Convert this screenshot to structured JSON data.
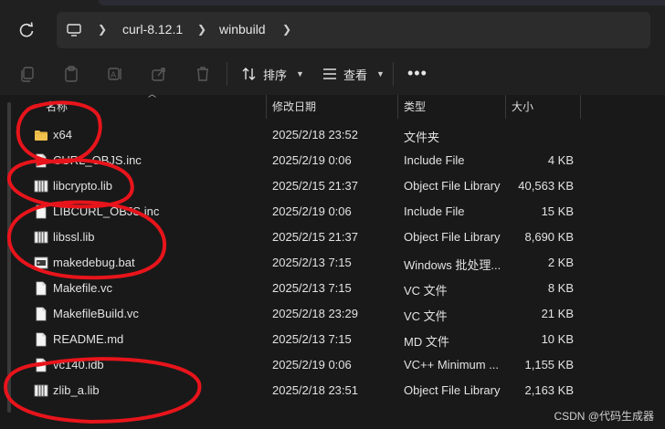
{
  "address": {
    "crumbs": [
      "curl-8.12.1",
      "winbuild"
    ]
  },
  "toolbar": {
    "sort_label": "排序",
    "view_label": "查看",
    "more_label": "•••"
  },
  "columns": {
    "name": "名称",
    "date": "修改日期",
    "type": "类型",
    "size": "大小"
  },
  "files": [
    {
      "name": "x64",
      "date": "2025/2/18 23:52",
      "type": "文件夹",
      "size": "",
      "icon": "folder-icon"
    },
    {
      "name": "CURL_OBJS.inc",
      "date": "2025/2/19 0:06",
      "type": "Include File",
      "size": "4 KB",
      "icon": "file-icon"
    },
    {
      "name": "libcrypto.lib",
      "date": "2025/2/15 21:37",
      "type": "Object File Library",
      "size": "40,563 KB",
      "icon": "library-icon"
    },
    {
      "name": "LIBCURL_OBJS.inc",
      "date": "2025/2/19 0:06",
      "type": "Include File",
      "size": "15 KB",
      "icon": "file-icon"
    },
    {
      "name": "libssl.lib",
      "date": "2025/2/15 21:37",
      "type": "Object File Library",
      "size": "8,690 KB",
      "icon": "library-icon"
    },
    {
      "name": "makedebug.bat",
      "date": "2025/2/13 7:15",
      "type": "Windows 批处理...",
      "size": "2 KB",
      "icon": "batch-file-icon"
    },
    {
      "name": "Makefile.vc",
      "date": "2025/2/13 7:15",
      "type": "VC 文件",
      "size": "8 KB",
      "icon": "file-icon"
    },
    {
      "name": "MakefileBuild.vc",
      "date": "2025/2/18 23:29",
      "type": "VC 文件",
      "size": "21 KB",
      "icon": "file-icon"
    },
    {
      "name": "README.md",
      "date": "2025/2/13 7:15",
      "type": "MD 文件",
      "size": "10 KB",
      "icon": "file-icon"
    },
    {
      "name": "vc140.idb",
      "date": "2025/2/19 0:06",
      "type": "VC++ Minimum ...",
      "size": "1,155 KB",
      "icon": "file-icon"
    },
    {
      "name": "zlib_a.lib",
      "date": "2025/2/18 23:51",
      "type": "Object File Library",
      "size": "2,163 KB",
      "icon": "library-icon"
    }
  ],
  "watermark": "CSDN @代码生成器",
  "colors": {
    "background": "#191919",
    "toolbar": "#202020",
    "annotation": "#e8141b",
    "folder": "#f2c14e"
  }
}
